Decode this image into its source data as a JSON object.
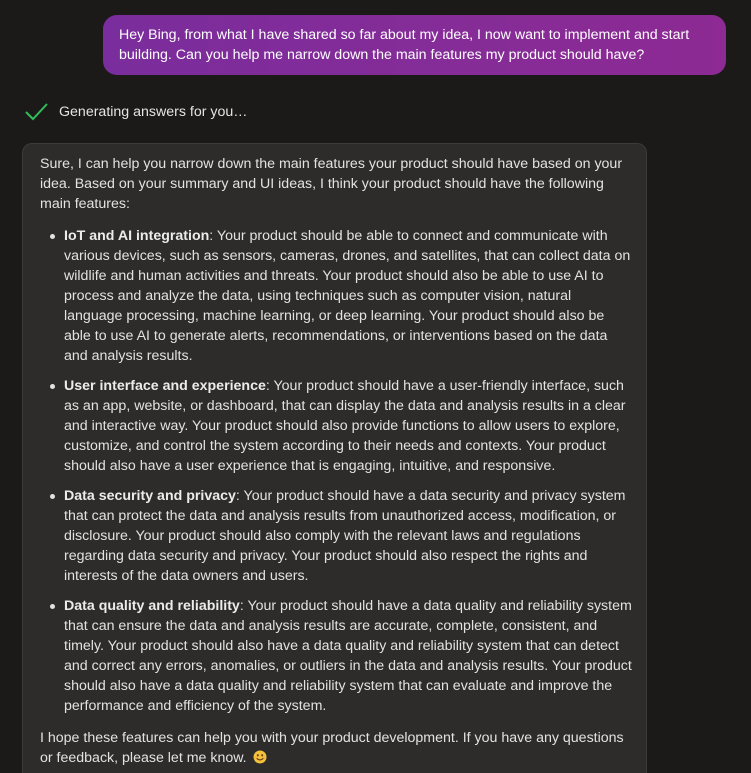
{
  "user_message": {
    "text": "Hey Bing, from what I have shared so far about my idea, I now want to implement and start building. Can you help me narrow down the main features my product should have?"
  },
  "status": {
    "icon": "check-icon",
    "text": "Generating answers for you…"
  },
  "bot_message": {
    "intro": "Sure, I can help you narrow down the main features your product should have based on your idea. Based on your summary and UI ideas, I think your product should have the following main features:",
    "features": [
      {
        "title": "IoT and AI integration",
        "body": ": Your product should be able to connect and communicate with various devices, such as sensors, cameras, drones, and satellites, that can collect data on wildlife and human activities and threats. Your product should also be able to use AI to process and analyze the data, using techniques such as computer vision, natural language processing, machine learning, or deep learning. Your product should also be able to use AI to generate alerts, recommendations, or interventions based on the data and analysis results."
      },
      {
        "title": "User interface and experience",
        "body": ": Your product should have a user-friendly interface, such as an app, website, or dashboard, that can display the data and analysis results in a clear and interactive way. Your product should also provide functions to allow users to explore, customize, and control the system according to their needs and contexts. Your product should also have a user experience that is engaging, intuitive, and responsive."
      },
      {
        "title": "Data security and privacy",
        "body": ": Your product should have a data security and privacy system that can protect the data and analysis results from unauthorized access, modification, or disclosure. Your product should also comply with the relevant laws and regulations regarding data security and privacy. Your product should also respect the rights and interests of the data owners and users."
      },
      {
        "title": "Data quality and reliability",
        "body": ": Your product should have a data quality and reliability system that can ensure the data and analysis results are accurate, complete, consistent, and timely. Your product should also have a data quality and reliability system that can detect and correct any errors, anomalies, or outliers in the data and analysis results. Your product should also have a data quality and reliability system that can evaluate and improve the performance and efficiency of the system."
      }
    ],
    "closing": "I hope these features can help you with your product development. If you have any questions or feedback, please let me know.",
    "closing_icon": "smiling-face-icon"
  },
  "colors": {
    "background": "#1b1a19",
    "user_bubble_start": "#7a2d9c",
    "user_bubble_end": "#8d2a93",
    "bot_bubble": "#2d2c2b",
    "check": "#2fbf5a"
  }
}
